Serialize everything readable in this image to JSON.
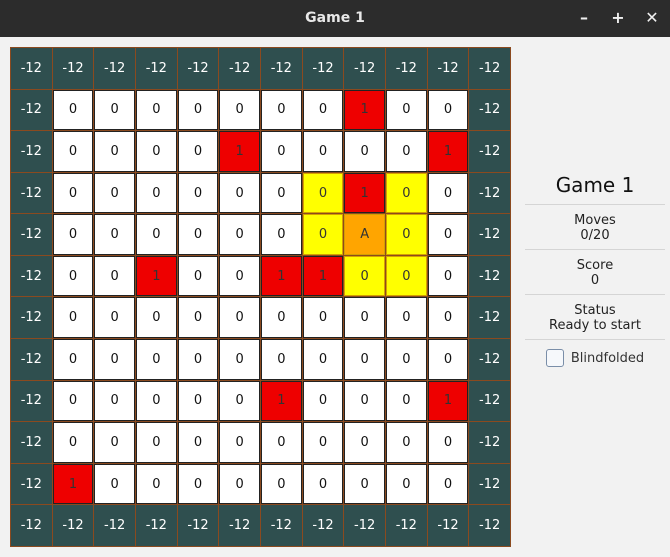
{
  "window": {
    "title": "Game 1",
    "minimize": "–",
    "maximize": "+",
    "close": "✕"
  },
  "board": {
    "rows": [
      [
        "-12",
        "-12",
        "-12",
        "-12",
        "-12",
        "-12",
        "-12",
        "-12",
        "-12",
        "-12",
        "-12",
        "-12"
      ],
      [
        "-12",
        "0",
        "0",
        "0",
        "0",
        "0",
        "0",
        "0",
        "1",
        "0",
        "0",
        "-12"
      ],
      [
        "-12",
        "0",
        "0",
        "0",
        "0",
        "1",
        "0",
        "0",
        "0",
        "0",
        "1",
        "-12"
      ],
      [
        "-12",
        "0",
        "0",
        "0",
        "0",
        "0",
        "0",
        "0",
        "1",
        "0",
        "0",
        "-12"
      ],
      [
        "-12",
        "0",
        "0",
        "0",
        "0",
        "0",
        "0",
        "0",
        "A",
        "0",
        "0",
        "-12"
      ],
      [
        "-12",
        "0",
        "0",
        "1",
        "0",
        "0",
        "1",
        "1",
        "0",
        "0",
        "0",
        "-12"
      ],
      [
        "-12",
        "0",
        "0",
        "0",
        "0",
        "0",
        "0",
        "0",
        "0",
        "0",
        "0",
        "-12"
      ],
      [
        "-12",
        "0",
        "0",
        "0",
        "0",
        "0",
        "0",
        "0",
        "0",
        "0",
        "0",
        "-12"
      ],
      [
        "-12",
        "0",
        "0",
        "0",
        "0",
        "0",
        "1",
        "0",
        "0",
        "0",
        "1",
        "-12"
      ],
      [
        "-12",
        "0",
        "0",
        "0",
        "0",
        "0",
        "0",
        "0",
        "0",
        "0",
        "0",
        "-12"
      ],
      [
        "-12",
        "1",
        "0",
        "0",
        "0",
        "0",
        "0",
        "0",
        "0",
        "0",
        "0",
        "-12"
      ],
      [
        "-12",
        "-12",
        "-12",
        "-12",
        "-12",
        "-12",
        "-12",
        "-12",
        "-12",
        "-12",
        "-12",
        "-12"
      ]
    ],
    "visible_cells": [
      [
        3,
        7
      ],
      [
        3,
        8
      ],
      [
        3,
        9
      ],
      [
        4,
        7
      ],
      [
        4,
        8
      ],
      [
        4,
        9
      ],
      [
        5,
        7
      ],
      [
        5,
        8
      ],
      [
        5,
        9
      ]
    ],
    "agent": [
      4,
      8
    ],
    "colors": {
      "wall": "#2f4f4f",
      "hazard": "#ee0000",
      "visible": "#ffff00",
      "agent": "#ffa500",
      "empty": "#ffffff"
    }
  },
  "panel": {
    "title": "Game 1",
    "moves_label": "Moves",
    "moves_value": "0/20",
    "score_label": "Score",
    "score_value": "0",
    "status_label": "Status",
    "status_value": "Ready to start",
    "blindfolded_label": "Blindfolded"
  }
}
